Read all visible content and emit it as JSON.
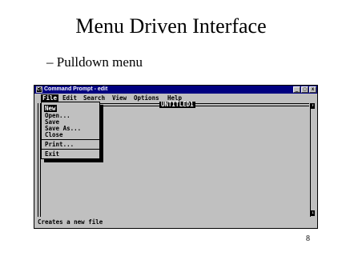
{
  "slide": {
    "title": "Menu Driven Interface",
    "bullet": "– Pulldown menu",
    "page_number": "8"
  },
  "window": {
    "title": "Command Prompt - edit",
    "icon_label": "C:\\",
    "buttons": {
      "minimize": "_",
      "maximize": "□",
      "close": "x"
    }
  },
  "menubar": [
    "File",
    "Edit",
    "Search",
    "View",
    "Options",
    "Help"
  ],
  "document_title": "UNTITLED1",
  "file_menu": {
    "items": [
      "New",
      "Open...",
      "Save",
      "Save As...",
      "Close",
      "Print...",
      "Exit"
    ]
  },
  "statusbar": "Creates a new file",
  "scroll_arrows": {
    "up": "↑",
    "down": "↓"
  }
}
